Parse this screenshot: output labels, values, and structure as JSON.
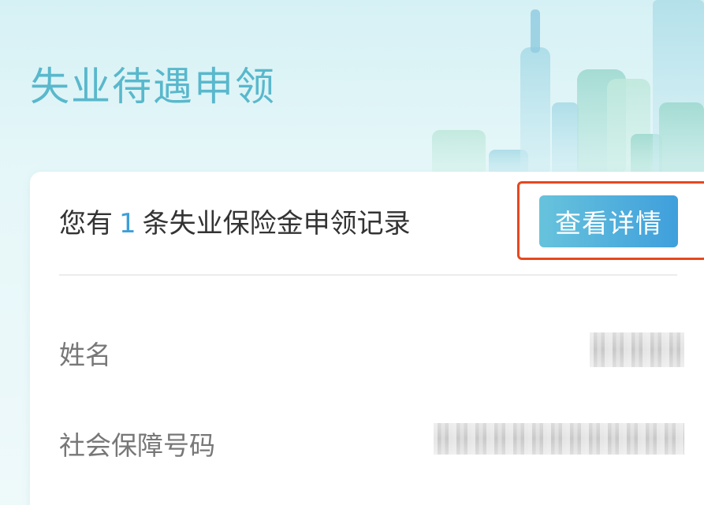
{
  "header": {
    "title": "失业待遇申领"
  },
  "record": {
    "prefix": "您有",
    "count": "1",
    "suffix": "条失业保险金申领记录",
    "detail_button_label": "查看详情"
  },
  "fields": [
    {
      "label": "姓名"
    },
    {
      "label": "社会保障号码"
    }
  ],
  "colors": {
    "title": "#59b8cc",
    "count": "#3d9fd8",
    "button_start": "#67c3dc",
    "button_end": "#3f9fdc",
    "highlight": "#e8471e"
  }
}
